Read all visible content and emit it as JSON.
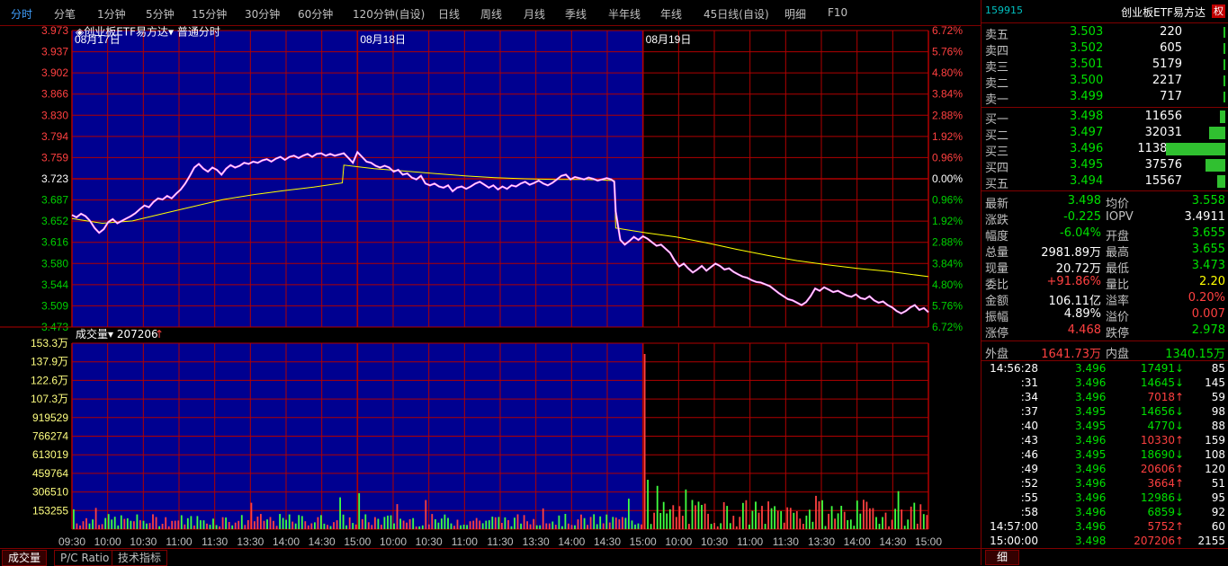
{
  "toolbar": {
    "tabs": [
      "分时",
      "分笔",
      "1分钟",
      "5分钟",
      "15分钟",
      "30分钟",
      "60分钟",
      "120分钟(自设)",
      "日线",
      "周线",
      "月线",
      "季线",
      "半年线",
      "年线",
      "45日线(自设)",
      "明细",
      "F10"
    ],
    "active": 0
  },
  "chart_header": {
    "title": "创业板ETF易方达",
    "mode": "普通分时",
    "days": [
      "08月17日",
      "08月18日",
      "08月19日"
    ]
  },
  "volume_header": {
    "label": "成交量",
    "value": "207206",
    "arrow": "↑"
  },
  "bottom_tabs": [
    "成交量",
    "P/C Ratio",
    "技术指标"
  ],
  "colors": {
    "bg_blue": "#000090",
    "grid": "#b00000",
    "axis_red": "#ff4040",
    "axis_green": "#00d000",
    "price": "#ffffff",
    "avg": "#ffff00",
    "vol_up": "#ff4040",
    "vol_down": "#40ff40"
  },
  "chart_data": {
    "type": "line",
    "price_labels": [
      "3.973",
      "3.937",
      "3.902",
      "3.866",
      "3.830",
      "3.794",
      "3.759",
      "3.723",
      "3.687",
      "3.652",
      "3.616",
      "3.580",
      "3.544",
      "3.509",
      "3.473"
    ],
    "pct_labels": [
      "6.72%",
      "5.76%",
      "4.80%",
      "3.84%",
      "2.88%",
      "1.92%",
      "0.96%",
      "0.00%",
      "0.96%",
      "1.92%",
      "2.88%",
      "3.84%",
      "4.80%",
      "5.76%",
      "6.72%"
    ],
    "vol_labels": [
      "153.3万",
      "137.9万",
      "122.6万",
      "107.3万",
      "919529",
      "766274",
      "613019",
      "459764",
      "306510",
      "153255"
    ],
    "x_labels": [
      "09:30",
      "10:00",
      "10:30",
      "11:00",
      "11:30",
      "13:30",
      "14:00",
      "14:30",
      "15:00",
      "10:00",
      "10:30",
      "11:00",
      "11:30",
      "13:30",
      "14:00",
      "14:30",
      "15:00",
      "10:00",
      "10:30",
      "11:00",
      "11:30",
      "13:30",
      "14:00",
      "14:30",
      "15:00"
    ],
    "ylim": [
      3.473,
      3.973
    ],
    "preclose": 3.723,
    "price": [
      [
        0,
        3.662
      ],
      [
        3,
        3.658
      ],
      [
        6,
        3.664
      ],
      [
        9,
        3.66
      ],
      [
        12,
        3.652
      ],
      [
        15,
        3.64
      ],
      [
        18,
        3.632
      ],
      [
        21,
        3.638
      ],
      [
        24,
        3.65
      ],
      [
        27,
        3.655
      ],
      [
        30,
        3.648
      ],
      [
        33,
        3.652
      ],
      [
        36,
        3.656
      ],
      [
        39,
        3.66
      ],
      [
        42,
        3.665
      ],
      [
        45,
        3.672
      ],
      [
        48,
        3.678
      ],
      [
        51,
        3.675
      ],
      [
        54,
        3.684
      ],
      [
        57,
        3.69
      ],
      [
        60,
        3.688
      ],
      [
        63,
        3.694
      ],
      [
        66,
        3.69
      ],
      [
        69,
        3.698
      ],
      [
        72,
        3.705
      ],
      [
        75,
        3.715
      ],
      [
        78,
        3.728
      ],
      [
        81,
        3.742
      ],
      [
        84,
        3.748
      ],
      [
        87,
        3.74
      ],
      [
        90,
        3.735
      ],
      [
        93,
        3.742
      ],
      [
        96,
        3.738
      ],
      [
        99,
        3.73
      ],
      [
        102,
        3.74
      ],
      [
        105,
        3.746
      ],
      [
        108,
        3.742
      ],
      [
        111,
        3.745
      ],
      [
        114,
        3.75
      ],
      [
        117,
        3.748
      ],
      [
        120,
        3.752
      ],
      [
        123,
        3.75
      ],
      [
        126,
        3.754
      ],
      [
        129,
        3.756
      ],
      [
        132,
        3.752
      ],
      [
        135,
        3.757
      ],
      [
        138,
        3.76
      ],
      [
        141,
        3.755
      ],
      [
        144,
        3.76
      ],
      [
        147,
        3.762
      ],
      [
        150,
        3.758
      ],
      [
        153,
        3.762
      ],
      [
        156,
        3.765
      ],
      [
        159,
        3.76
      ],
      [
        162,
        3.765
      ],
      [
        165,
        3.766
      ],
      [
        168,
        3.762
      ],
      [
        171,
        3.765
      ],
      [
        174,
        3.762
      ],
      [
        177,
        3.764
      ],
      [
        180,
        3.766
      ],
      [
        183,
        3.758
      ],
      [
        186,
        3.75
      ],
      [
        189,
        3.768
      ],
      [
        192,
        3.76
      ],
      [
        195,
        3.752
      ],
      [
        198,
        3.75
      ],
      [
        201,
        3.745
      ],
      [
        204,
        3.742
      ],
      [
        207,
        3.745
      ],
      [
        210,
        3.742
      ],
      [
        213,
        3.735
      ],
      [
        216,
        3.738
      ],
      [
        219,
        3.73
      ],
      [
        222,
        3.732
      ],
      [
        225,
        3.725
      ],
      [
        228,
        3.722
      ],
      [
        231,
        3.728
      ],
      [
        234,
        3.715
      ],
      [
        237,
        3.712
      ],
      [
        240,
        3.715
      ],
      [
        243,
        3.71
      ],
      [
        246,
        3.708
      ],
      [
        249,
        3.712
      ],
      [
        252,
        3.702
      ],
      [
        255,
        3.708
      ],
      [
        258,
        3.71
      ],
      [
        261,
        3.706
      ],
      [
        264,
        3.71
      ],
      [
        267,
        3.715
      ],
      [
        270,
        3.718
      ],
      [
        273,
        3.713
      ],
      [
        276,
        3.708
      ],
      [
        279,
        3.712
      ],
      [
        282,
        3.705
      ],
      [
        285,
        3.71
      ],
      [
        288,
        3.706
      ],
      [
        291,
        3.712
      ],
      [
        294,
        3.71
      ],
      [
        297,
        3.715
      ],
      [
        300,
        3.718
      ],
      [
        303,
        3.713
      ],
      [
        306,
        3.716
      ],
      [
        309,
        3.72
      ],
      [
        312,
        3.715
      ],
      [
        315,
        3.712
      ],
      [
        318,
        3.716
      ],
      [
        321,
        3.722
      ],
      [
        324,
        3.728
      ],
      [
        327,
        3.73
      ],
      [
        330,
        3.722
      ],
      [
        333,
        3.726
      ],
      [
        336,
        3.724
      ],
      [
        339,
        3.722
      ],
      [
        342,
        3.725
      ],
      [
        345,
        3.723
      ],
      [
        348,
        3.72
      ],
      [
        351,
        3.722
      ],
      [
        354,
        3.724
      ],
      [
        357,
        3.722
      ],
      [
        359,
        3.718
      ],
      [
        360,
        3.668
      ],
      [
        363,
        3.62
      ],
      [
        366,
        3.612
      ],
      [
        369,
        3.618
      ],
      [
        372,
        3.625
      ],
      [
        375,
        3.62
      ],
      [
        378,
        3.626
      ],
      [
        381,
        3.622
      ],
      [
        384,
        3.616
      ],
      [
        387,
        3.61
      ],
      [
        390,
        3.612
      ],
      [
        393,
        3.605
      ],
      [
        396,
        3.598
      ],
      [
        399,
        3.585
      ],
      [
        402,
        3.575
      ],
      [
        405,
        3.58
      ],
      [
        408,
        3.572
      ],
      [
        411,
        3.565
      ],
      [
        414,
        3.57
      ],
      [
        417,
        3.576
      ],
      [
        420,
        3.568
      ],
      [
        423,
        3.574
      ],
      [
        426,
        3.58
      ],
      [
        429,
        3.576
      ],
      [
        432,
        3.57
      ],
      [
        435,
        3.572
      ],
      [
        438,
        3.566
      ],
      [
        441,
        3.562
      ],
      [
        444,
        3.558
      ],
      [
        447,
        3.556
      ],
      [
        450,
        3.552
      ],
      [
        453,
        3.549
      ],
      [
        456,
        3.548
      ],
      [
        459,
        3.545
      ],
      [
        462,
        3.542
      ],
      [
        465,
        3.536
      ],
      [
        468,
        3.53
      ],
      [
        471,
        3.525
      ],
      [
        474,
        3.52
      ],
      [
        477,
        3.518
      ],
      [
        480,
        3.514
      ],
      [
        483,
        3.51
      ],
      [
        486,
        3.515
      ],
      [
        489,
        3.525
      ],
      [
        492,
        3.538
      ],
      [
        495,
        3.534
      ],
      [
        498,
        3.54
      ],
      [
        501,
        3.536
      ],
      [
        504,
        3.532
      ],
      [
        507,
        3.534
      ],
      [
        510,
        3.53
      ],
      [
        513,
        3.526
      ],
      [
        516,
        3.524
      ],
      [
        519,
        3.528
      ],
      [
        522,
        3.522
      ],
      [
        525,
        3.52
      ],
      [
        528,
        3.525
      ],
      [
        531,
        3.518
      ],
      [
        534,
        3.514
      ],
      [
        537,
        3.516
      ],
      [
        540,
        3.51
      ],
      [
        543,
        3.506
      ],
      [
        546,
        3.5
      ],
      [
        549,
        3.496
      ],
      [
        552,
        3.5
      ],
      [
        555,
        3.506
      ],
      [
        558,
        3.51
      ],
      [
        561,
        3.502
      ],
      [
        564,
        3.505
      ],
      [
        567,
        3.498
      ]
    ],
    "avg": [
      [
        0,
        3.656
      ],
      [
        20,
        3.648
      ],
      [
        40,
        3.652
      ],
      [
        60,
        3.664
      ],
      [
        80,
        3.676
      ],
      [
        100,
        3.688
      ],
      [
        120,
        3.696
      ],
      [
        140,
        3.703
      ],
      [
        160,
        3.709
      ],
      [
        179,
        3.716
      ],
      [
        180,
        3.746
      ],
      [
        200,
        3.74
      ],
      [
        220,
        3.736
      ],
      [
        240,
        3.732
      ],
      [
        260,
        3.728
      ],
      [
        280,
        3.725
      ],
      [
        300,
        3.723
      ],
      [
        320,
        3.722
      ],
      [
        340,
        3.722
      ],
      [
        359,
        3.72
      ],
      [
        360,
        3.64
      ],
      [
        380,
        3.632
      ],
      [
        400,
        3.625
      ],
      [
        420,
        3.615
      ],
      [
        440,
        3.604
      ],
      [
        460,
        3.594
      ],
      [
        480,
        3.585
      ],
      [
        500,
        3.578
      ],
      [
        520,
        3.572
      ],
      [
        540,
        3.567
      ],
      [
        567,
        3.558
      ]
    ],
    "volume_max": 1533000
  },
  "panel": {
    "code": "159915",
    "name": "创业板ETF易方达",
    "right_badge": "权",
    "sell": [
      {
        "label": "卖五",
        "price": "3.503",
        "vol": "220"
      },
      {
        "label": "卖四",
        "price": "3.502",
        "vol": "605"
      },
      {
        "label": "卖三",
        "price": "3.501",
        "vol": "5179"
      },
      {
        "label": "卖二",
        "price": "3.500",
        "vol": "2217"
      },
      {
        "label": "卖一",
        "price": "3.499",
        "vol": "717"
      }
    ],
    "buy": [
      {
        "label": "买一",
        "price": "3.498",
        "vol": "11656",
        "bar": 0.09
      },
      {
        "label": "买二",
        "price": "3.497",
        "vol": "32031",
        "bar": 0.28
      },
      {
        "label": "买三",
        "price": "3.496",
        "vol": "113861",
        "bar": 1.0
      },
      {
        "label": "买四",
        "price": "3.495",
        "vol": "37576",
        "bar": 0.33
      },
      {
        "label": "买五",
        "price": "3.494",
        "vol": "15567",
        "bar": 0.14
      }
    ],
    "stats": [
      {
        "l1": "最新",
        "v1": "3.498",
        "c1": "c-green",
        "l2": "均价",
        "v2": "3.558",
        "c2": "c-green"
      },
      {
        "l1": "涨跌",
        "v1": "-0.225",
        "c1": "c-green",
        "l2": "IOPV",
        "v2": "3.4911",
        "c2": "c-white"
      },
      {
        "l1": "幅度",
        "v1": "-6.04%",
        "c1": "c-green",
        "l2": "开盘",
        "v2": "3.655",
        "c2": "c-green"
      },
      {
        "l1": "总量",
        "v1": "2981.89万",
        "c1": "c-white",
        "l2": "最高",
        "v2": "3.655",
        "c2": "c-green"
      },
      {
        "l1": "现量",
        "v1": "20.72万",
        "c1": "c-white",
        "l2": "最低",
        "v2": "3.473",
        "c2": "c-green"
      },
      {
        "l1": "委比",
        "v1": "+91.86%",
        "c1": "c-red",
        "l2": "量比",
        "v2": "2.20",
        "c2": "c-yellow"
      },
      {
        "l1": "金额",
        "v1": "106.11亿",
        "c1": "c-white",
        "l2": "溢率",
        "v2": "0.20%",
        "c2": "c-red"
      },
      {
        "l1": "振幅",
        "v1": "4.89%",
        "c1": "c-white",
        "l2": "溢价",
        "v2": "0.007",
        "c2": "c-red"
      },
      {
        "l1": "涨停",
        "v1": "4.468",
        "c1": "c-red",
        "l2": "跌停",
        "v2": "2.978",
        "c2": "c-green"
      }
    ],
    "outer_label": "外盘",
    "outer_val": "1641.73万",
    "inner_label": "内盘",
    "inner_val": "1340.15万",
    "ticks": [
      {
        "t": "14:56:28",
        "p": "3.496",
        "v": "17491",
        "d": "down",
        "n": "85"
      },
      {
        "t": ":31",
        "p": "3.496",
        "v": "14645",
        "d": "down",
        "n": "145"
      },
      {
        "t": ":34",
        "p": "3.496",
        "v": "7018",
        "d": "up",
        "n": "59"
      },
      {
        "t": ":37",
        "p": "3.495",
        "v": "14656",
        "d": "down",
        "n": "98"
      },
      {
        "t": ":40",
        "p": "3.495",
        "v": "4770",
        "d": "down",
        "n": "88"
      },
      {
        "t": ":43",
        "p": "3.496",
        "v": "10330",
        "d": "up",
        "n": "159"
      },
      {
        "t": ":46",
        "p": "3.495",
        "v": "18690",
        "d": "down",
        "n": "108"
      },
      {
        "t": ":49",
        "p": "3.496",
        "v": "20606",
        "d": "up",
        "n": "120"
      },
      {
        "t": ":52",
        "p": "3.496",
        "v": "3664",
        "d": "up",
        "n": "51"
      },
      {
        "t": ":55",
        "p": "3.496",
        "v": "12986",
        "d": "down",
        "n": "95"
      },
      {
        "t": ":58",
        "p": "3.496",
        "v": "6859",
        "d": "down",
        "n": "92"
      },
      {
        "t": "14:57:00",
        "p": "3.496",
        "v": "5752",
        "d": "up",
        "n": "60"
      },
      {
        "t": "15:00:00",
        "p": "3.498",
        "v": "207206",
        "d": "up",
        "n": "2155"
      }
    ],
    "bottom_tab": "细"
  }
}
